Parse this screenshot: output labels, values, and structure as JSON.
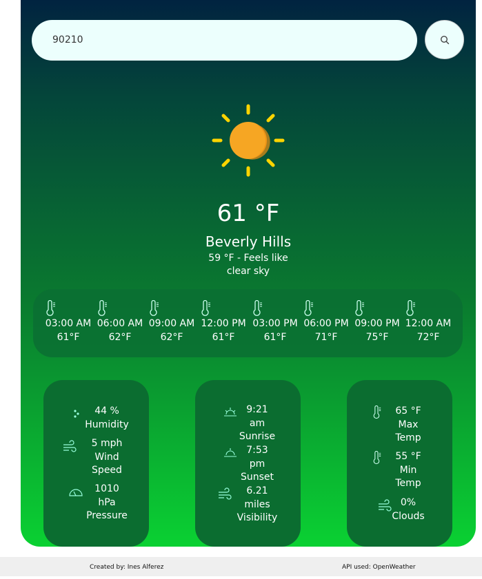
{
  "search": {
    "value": "90210"
  },
  "current": {
    "temp": "61 °F",
    "city": "Beverly Hills",
    "feels_like": "59 °F - Feels like",
    "description": "clear sky",
    "icon": "sun-icon"
  },
  "forecast": [
    {
      "time": "03:00 AM",
      "temp": "61°F"
    },
    {
      "time": "06:00 AM",
      "temp": "62°F"
    },
    {
      "time": "09:00 AM",
      "temp": "62°F"
    },
    {
      "time": "12:00 PM",
      "temp": "61°F"
    },
    {
      "time": "03:00 PM",
      "temp": "61°F"
    },
    {
      "time": "06:00 PM",
      "temp": "71°F"
    },
    {
      "time": "09:00 PM",
      "temp": "75°F"
    },
    {
      "time": "12:00 AM",
      "temp": "72°F"
    }
  ],
  "details": {
    "humidity": {
      "value": "44 %",
      "label": "Humidity"
    },
    "wind": {
      "value": "5 mph",
      "label1": "Wind",
      "label2": "Speed"
    },
    "pressure": {
      "value": "1010",
      "unit": "hPa",
      "label": "Pressure"
    },
    "sunrise": {
      "value": "9:21",
      "ampm": "am",
      "label": "Sunrise"
    },
    "sunset": {
      "value": "7:53",
      "ampm": "pm",
      "label": "Sunset"
    },
    "visibility": {
      "value": "6.21",
      "unit": "miles",
      "label": "Visibility"
    },
    "max_temp": {
      "value": "65 °F",
      "label1": "Max",
      "label2": "Temp"
    },
    "min_temp": {
      "value": "55 °F",
      "label1": "Min",
      "label2": "Temp"
    },
    "clouds": {
      "value": "0%",
      "label": "Clouds"
    }
  },
  "footer": {
    "credit": "Created by: Ines Alferez",
    "api": "API used: OpenWeather"
  },
  "colors": {
    "accent_sun": "#f6a623",
    "sun_rays": "#ffd400",
    "card": "#0b6d30"
  }
}
